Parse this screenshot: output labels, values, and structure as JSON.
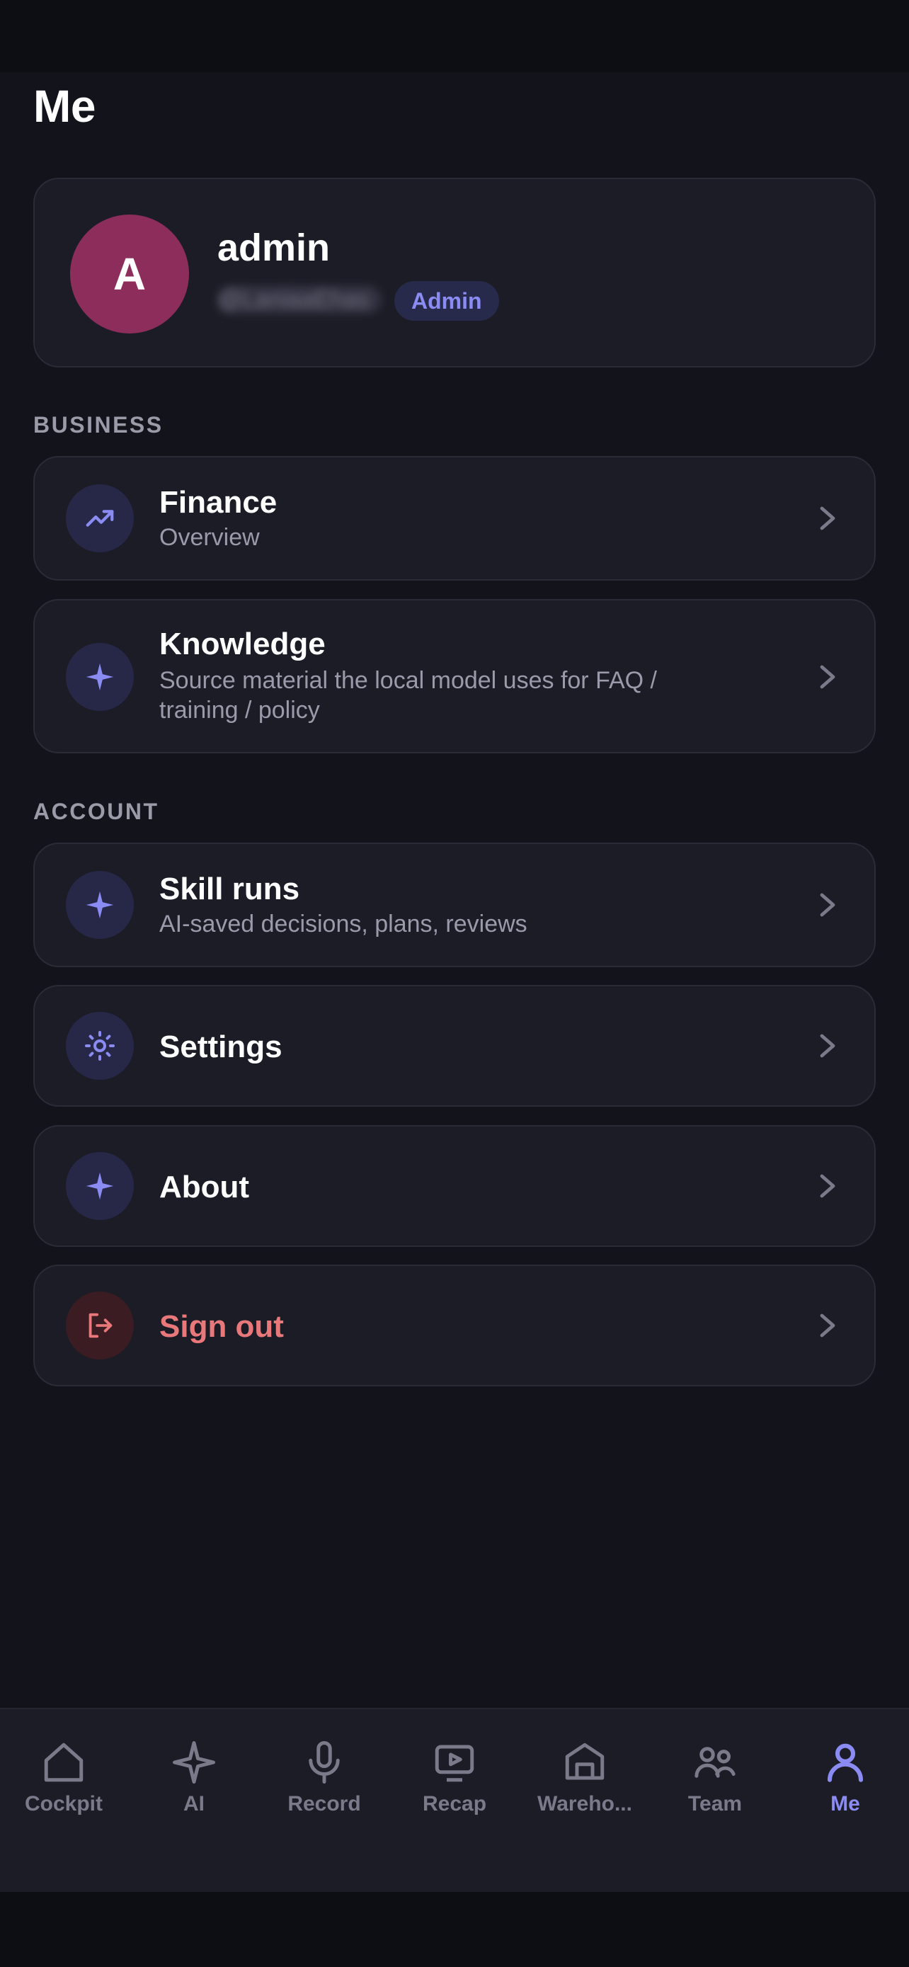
{
  "page": {
    "title": "Me"
  },
  "profile": {
    "avatar_letter": "A",
    "name": "admin",
    "handle": "@LaniaaEhas",
    "role_badge": "Admin",
    "avatar_color": "#8c2d5b"
  },
  "sections": {
    "business_label": "BUSINESS",
    "account_label": "ACCOUNT"
  },
  "rows": {
    "finance": {
      "title": "Finance",
      "subtitle": "Overview",
      "icon": "trending-up-icon"
    },
    "knowledge": {
      "title": "Knowledge",
      "subtitle": "Source material the local model uses for FAQ / training / policy",
      "icon": "sparkle-icon"
    },
    "skill_runs": {
      "title": "Skill runs",
      "subtitle": "AI-saved decisions, plans, reviews",
      "icon": "sparkle-icon"
    },
    "settings": {
      "title": "Settings",
      "icon": "sun-gear-icon"
    },
    "about": {
      "title": "About",
      "icon": "sparkle-icon"
    },
    "sign_out": {
      "title": "Sign out",
      "icon": "sign-out-icon"
    }
  },
  "tabs": [
    {
      "label": "Cockpit",
      "icon": "home-icon"
    },
    {
      "label": "AI",
      "icon": "sparkle-icon"
    },
    {
      "label": "Record",
      "icon": "microphone-icon"
    },
    {
      "label": "Recap",
      "icon": "video-screen-icon"
    },
    {
      "label": "Wareho...",
      "icon": "warehouse-icon"
    },
    {
      "label": "Team",
      "icon": "team-icon"
    },
    {
      "label": "Me",
      "icon": "user-icon",
      "active": true
    }
  ],
  "colors": {
    "accent": "#8b8cf3",
    "danger": "#e8787a",
    "background": "#13131c",
    "card": "#1c1c27"
  }
}
